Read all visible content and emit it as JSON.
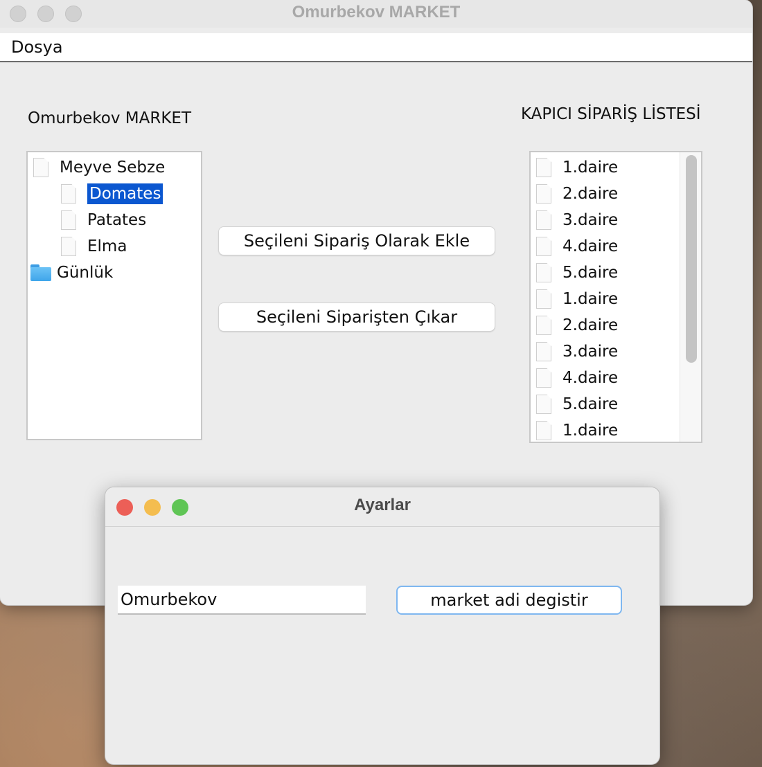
{
  "main_window": {
    "title": "Omurbekov MARKET",
    "menu": [
      "Dosya"
    ],
    "left_label": "Omurbekov MARKET",
    "right_label": "KAPICI SİPARİŞ LİSTESİ",
    "tree": [
      {
        "label": "Meyve Sebze",
        "level": 0,
        "icon": "document-icon"
      },
      {
        "label": "Domates",
        "level": 1,
        "icon": "document-icon",
        "selected": true
      },
      {
        "label": "Patates",
        "level": 1,
        "icon": "document-icon"
      },
      {
        "label": "Elma",
        "level": 1,
        "icon": "document-icon"
      },
      {
        "label": "Günlük",
        "level": 0,
        "icon": "folder-icon"
      }
    ],
    "buttons": {
      "add": "Seçileni Sipariş Olarak Ekle",
      "remove": "Seçileni Siparişten Çıkar"
    },
    "order_list": [
      "1.daire",
      "2.daire",
      "3.daire",
      "4.daire",
      "5.daire",
      "1.daire",
      "2.daire",
      "3.daire",
      "4.daire",
      "5.daire",
      "1.daire"
    ]
  },
  "settings_window": {
    "title": "Ayarlar",
    "market_name_value": "Omurbekov",
    "change_button": "market adi degistir"
  },
  "colors": {
    "selection": "#0b57d0",
    "close": "#ec5f57",
    "minimize": "#f4bd4f",
    "zoom": "#5fc555",
    "focus_ring": "#7fb7f0"
  }
}
